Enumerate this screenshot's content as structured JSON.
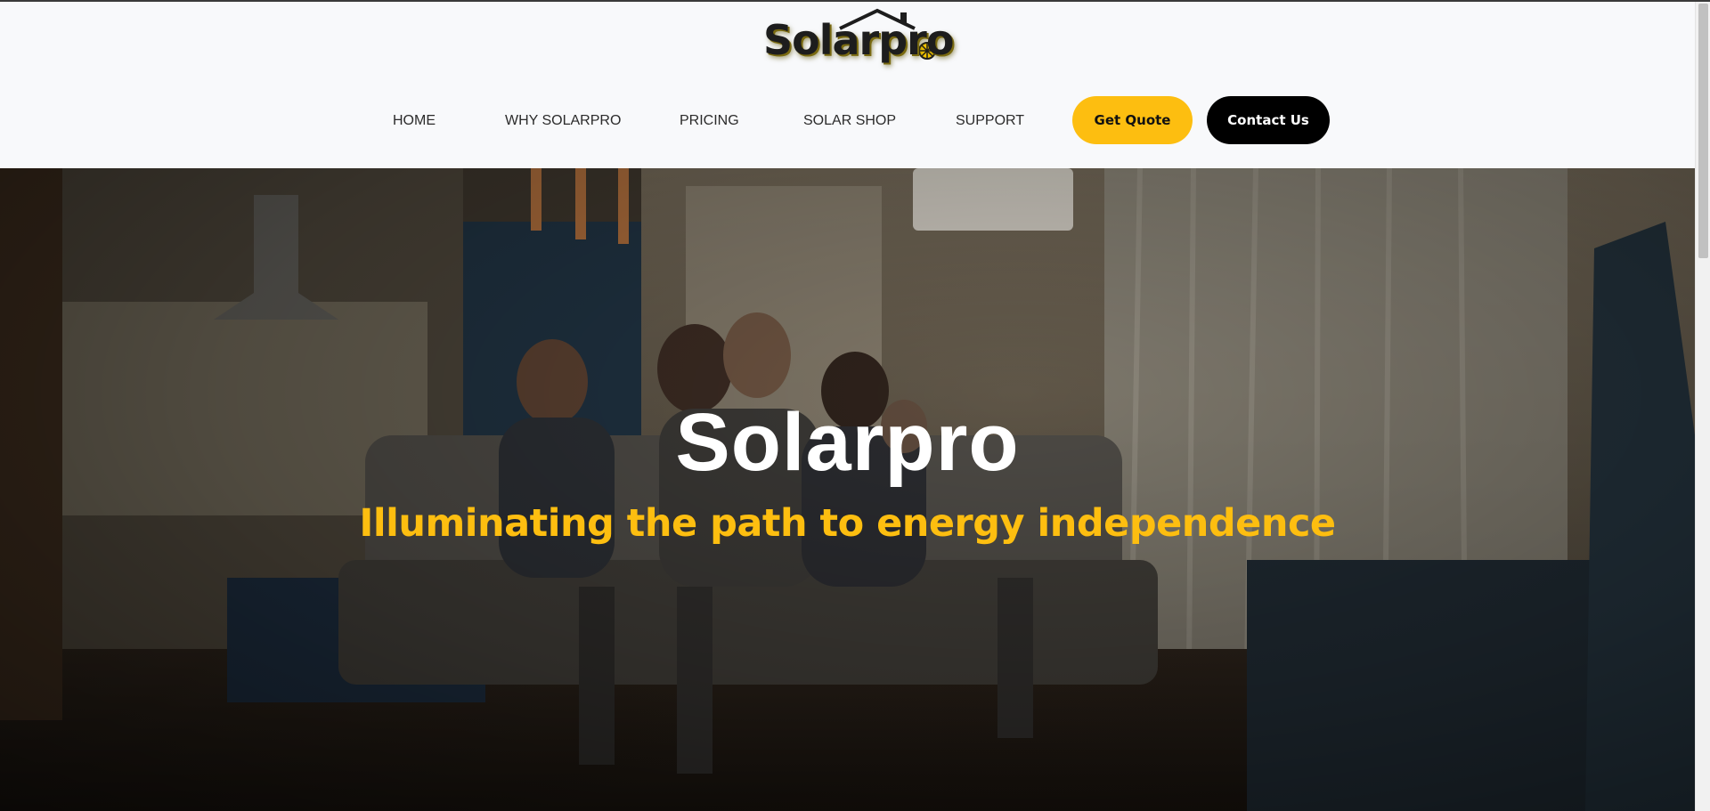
{
  "brand": {
    "logo_text": "Solarpro",
    "accent_color": "#fdbe10"
  },
  "nav": {
    "items": [
      {
        "label": "HOME"
      },
      {
        "label": "WHY SOLARPRO"
      },
      {
        "label": "PRICING"
      },
      {
        "label": "SOLAR SHOP"
      },
      {
        "label": "SUPPORT"
      }
    ],
    "get_quote_label": "Get Quote",
    "contact_label": "Contact Us"
  },
  "hero": {
    "title": "Solarpro",
    "tagline": "Illuminating the path to energy independence",
    "background_image": "family-on-sofa-living-room-photo"
  },
  "icons": {
    "logo_mark": "house-roof-sun-icon"
  }
}
